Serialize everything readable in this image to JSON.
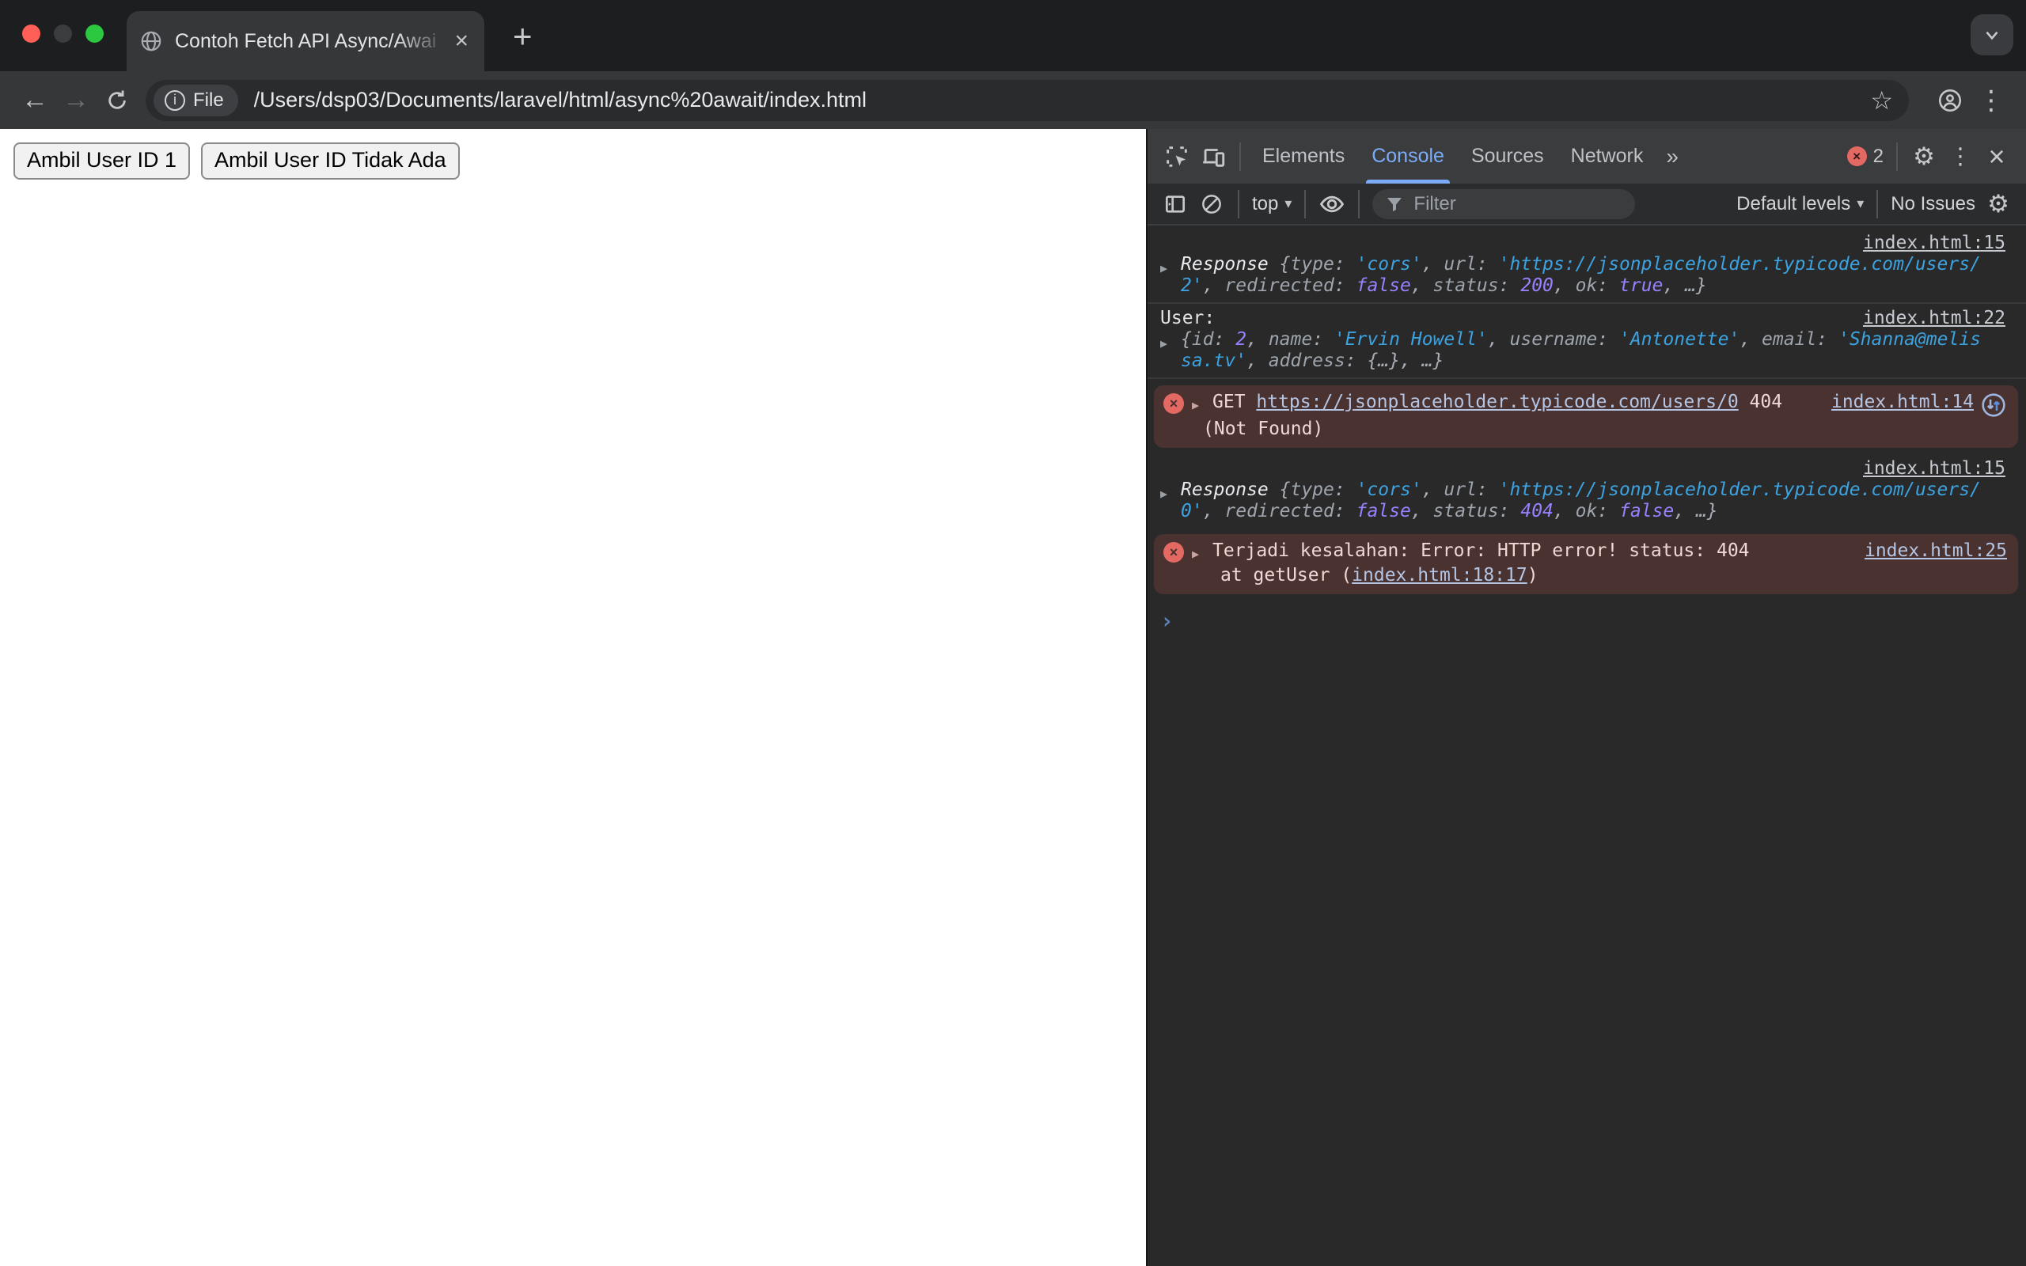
{
  "browser": {
    "tab_title": "Contoh Fetch API Async/Awai",
    "url": "/Users/dsp03/Documents/laravel/html/async%20await/index.html",
    "file_chip": "File"
  },
  "icons": {
    "plus": "+",
    "close": "×",
    "star": "☆",
    "kebab": "⋮",
    "gear": "⚙",
    "more_tabs": "»",
    "caret_down": "▾",
    "back": "←",
    "forward": "→",
    "expand": "▶",
    "prompt": "›",
    "info": "i",
    "error_x": "×"
  },
  "page": {
    "buttons": [
      "Ambil User ID 1",
      "Ambil User ID Tidak Ada"
    ]
  },
  "devtools": {
    "tabs": {
      "elements": "Elements",
      "console": "Console",
      "sources": "Sources",
      "network": "Network"
    },
    "error_count": "2",
    "toolbar": {
      "context": "top",
      "filter_placeholder": "Filter",
      "levels": "Default levels",
      "issues": "No Issues"
    },
    "messages": [
      {
        "source": "index.html:15",
        "tokens": [
          {
            "t": "o",
            "v": "Response "
          },
          {
            "t": "p",
            "v": "{"
          },
          {
            "t": "k",
            "v": "type"
          },
          {
            "t": "p",
            "v": ": "
          },
          {
            "t": "s",
            "v": "'cors'"
          },
          {
            "t": "p",
            "v": ", "
          },
          {
            "t": "k",
            "v": "url"
          },
          {
            "t": "p",
            "v": ": "
          },
          {
            "t": "s",
            "v": "'https://jsonplaceholder.typicode.com/users/2'"
          },
          {
            "t": "p",
            "v": ", "
          },
          {
            "t": "k",
            "v": "redirected"
          },
          {
            "t": "p",
            "v": ": "
          },
          {
            "t": "n",
            "v": "false"
          },
          {
            "t": "p",
            "v": ", "
          },
          {
            "t": "k",
            "v": "status"
          },
          {
            "t": "p",
            "v": ": "
          },
          {
            "t": "n",
            "v": "200"
          },
          {
            "t": "p",
            "v": ", "
          },
          {
            "t": "k",
            "v": "ok"
          },
          {
            "t": "p",
            "v": ": "
          },
          {
            "t": "n",
            "v": "true"
          },
          {
            "t": "p",
            "v": ", …}"
          }
        ]
      },
      {
        "lead": "User:",
        "source": "index.html:22",
        "tokens": [
          {
            "t": "p",
            "v": "{"
          },
          {
            "t": "k",
            "v": "id"
          },
          {
            "t": "p",
            "v": ": "
          },
          {
            "t": "n",
            "v": "2"
          },
          {
            "t": "p",
            "v": ", "
          },
          {
            "t": "k",
            "v": "name"
          },
          {
            "t": "p",
            "v": ": "
          },
          {
            "t": "s",
            "v": "'Ervin Howell'"
          },
          {
            "t": "p",
            "v": ", "
          },
          {
            "t": "k",
            "v": "username"
          },
          {
            "t": "p",
            "v": ": "
          },
          {
            "t": "s",
            "v": "'Antonette'"
          },
          {
            "t": "p",
            "v": ", "
          },
          {
            "t": "k",
            "v": "email"
          },
          {
            "t": "p",
            "v": ": "
          },
          {
            "t": "s",
            "v": "'Shanna@melissa.tv'"
          },
          {
            "t": "p",
            "v": ", "
          },
          {
            "t": "k",
            "v": "address"
          },
          {
            "t": "p",
            "v": ": "
          },
          {
            "t": "p",
            "v": "{…}"
          },
          {
            "t": "p",
            "v": ", …}"
          }
        ]
      },
      {
        "source": "index.html:14",
        "line1": [
          {
            "t": "e",
            "v": "GET "
          },
          {
            "t": "el",
            "v": "https://jsonplaceholder.typicode.com/users/0"
          },
          {
            "t": "e",
            "v": " 404"
          }
        ],
        "line2": [
          {
            "t": "e",
            "v": "(Not Found)"
          }
        ]
      },
      {
        "source": "index.html:15",
        "tokens": [
          {
            "t": "o",
            "v": "Response "
          },
          {
            "t": "p",
            "v": "{"
          },
          {
            "t": "k",
            "v": "type"
          },
          {
            "t": "p",
            "v": ": "
          },
          {
            "t": "s",
            "v": "'cors'"
          },
          {
            "t": "p",
            "v": ", "
          },
          {
            "t": "k",
            "v": "url"
          },
          {
            "t": "p",
            "v": ": "
          },
          {
            "t": "s",
            "v": "'https://jsonplaceholder.typicode.com/users/0'"
          },
          {
            "t": "p",
            "v": ", "
          },
          {
            "t": "k",
            "v": "redirected"
          },
          {
            "t": "p",
            "v": ": "
          },
          {
            "t": "n",
            "v": "false"
          },
          {
            "t": "p",
            "v": ", "
          },
          {
            "t": "k",
            "v": "status"
          },
          {
            "t": "p",
            "v": ": "
          },
          {
            "t": "n",
            "v": "404"
          },
          {
            "t": "p",
            "v": ", "
          },
          {
            "t": "k",
            "v": "ok"
          },
          {
            "t": "p",
            "v": ": "
          },
          {
            "t": "n",
            "v": "false"
          },
          {
            "t": "p",
            "v": ", …}"
          }
        ]
      },
      {
        "source": "index.html:25",
        "line1": [
          {
            "t": "e",
            "v": "Terjadi kesalahan: Error: HTTP error! status: 404"
          }
        ],
        "line2": [
          {
            "t": "e",
            "v": "at getUser ("
          },
          {
            "t": "el",
            "v": "index.html:18:17"
          },
          {
            "t": "e",
            "v": ")"
          }
        ]
      }
    ]
  }
}
